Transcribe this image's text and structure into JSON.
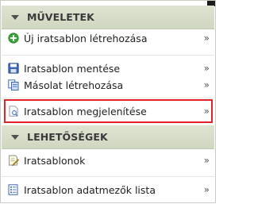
{
  "sections": {
    "actions": {
      "title": "MŰVELETEK",
      "items": [
        {
          "label": "Új iratsablon létrehozása",
          "icon": "green-plus-icon"
        },
        {
          "label": "Iratsablon mentése",
          "icon": "save-icon"
        },
        {
          "label": "Másolat létrehozása",
          "icon": "copy-icon"
        },
        {
          "label": "Iratsablon megjelenítése",
          "icon": "preview-document-icon"
        }
      ]
    },
    "options": {
      "title": "LEHETŐSÉGEK",
      "items": [
        {
          "label": "Iratsablonok",
          "icon": "edit-document-icon"
        },
        {
          "label": "Iratsablon adatmezők lista",
          "icon": "list-document-icon"
        }
      ]
    }
  },
  "chevron": "»",
  "colors": {
    "highlight_border": "#e3222a",
    "header_bg": "#d7ddc9"
  }
}
